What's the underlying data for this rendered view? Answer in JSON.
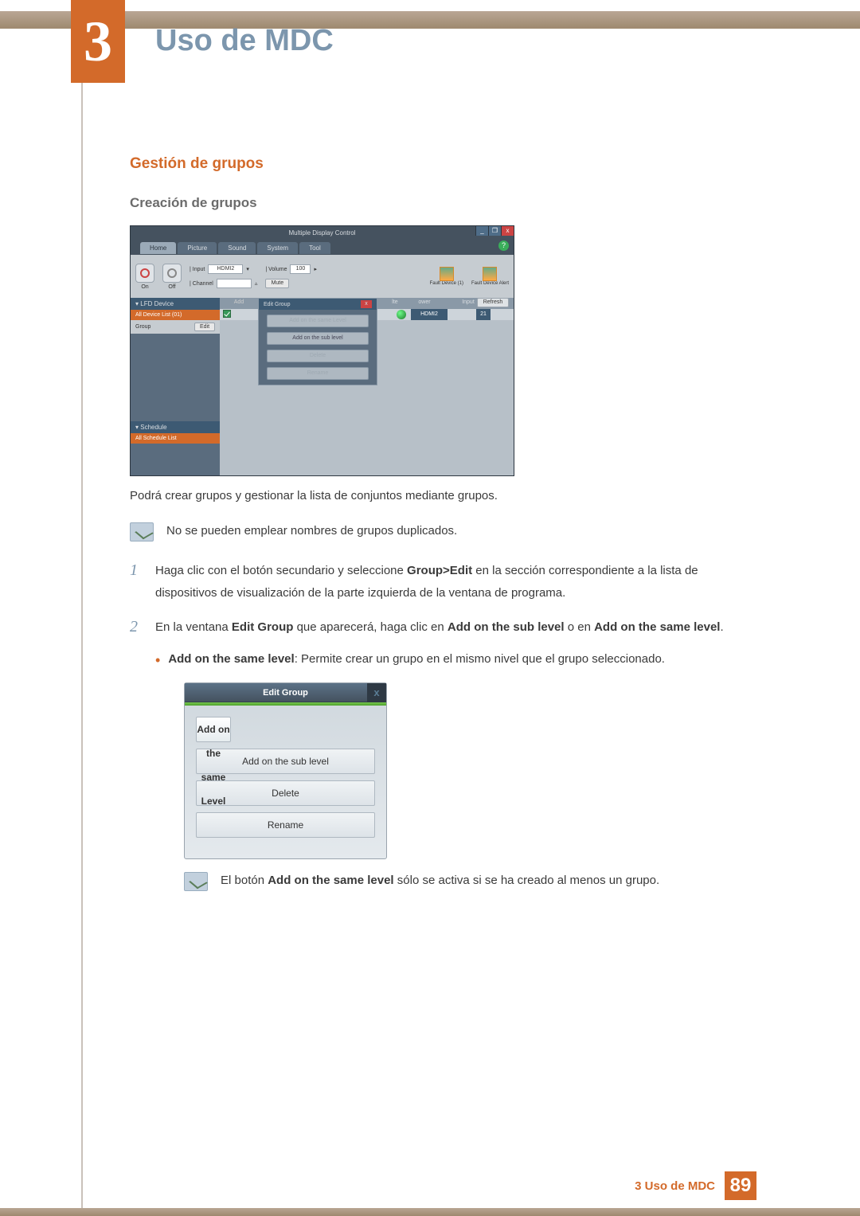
{
  "chapter": {
    "number": "3",
    "title": "Uso de MDC"
  },
  "h1": "Gestión de grupos",
  "h2": "Creación de grupos",
  "mdc": {
    "title": "Multiple Display Control",
    "win_min": "_",
    "win_max": "❐",
    "win_close": "x",
    "help": "?",
    "tabs": [
      "Home",
      "Picture",
      "Sound",
      "System",
      "Tool"
    ],
    "toolbar": {
      "on": "On",
      "off": "Off",
      "input_label": "| Input",
      "input_value": "HDMI2",
      "channel_label": "| Channel",
      "volume_label": "| Volume",
      "volume_value": "100",
      "mute": "Mute",
      "fault_log": "Fault Device (1)",
      "fault_alert": "Fault Device Alert"
    },
    "sidebar": {
      "lfd": "▾  LFD Device",
      "all_dev": "All Device List (01)",
      "group": "Group",
      "edit": "Edit",
      "schedule": "▾  Schedule",
      "all_sched": "All Schedule List"
    },
    "main": {
      "add": "Add",
      "refresh": "Refresh",
      "col_lte": "lte",
      "col_power": "ower",
      "col_input": "Input",
      "row_input": "HDMI2",
      "row_num": "21"
    },
    "popup": {
      "title": "Edit Group",
      "close": "x",
      "b1": "Add on the same Level",
      "b2": "Add on the sub level",
      "b3": "Delete",
      "b4": "Rename"
    }
  },
  "p_after": "Podrá crear grupos y gestionar la lista de conjuntos mediante grupos.",
  "note1": "No se pueden emplear nombres de grupos duplicados.",
  "steps": {
    "s1_num": "1",
    "s1_a": "Haga clic con el botón secundario y seleccione ",
    "s1_b": "Group>Edit",
    "s1_c": " en la sección correspondiente a la lista de dispositivos de visualización de la parte izquierda de la ventana de programa.",
    "s2_num": "2",
    "s2_a": "En la ventana ",
    "s2_b": "Edit Group",
    "s2_c": " que aparecerá, haga clic en ",
    "s2_d": "Add on the sub level",
    "s2_e": " o en ",
    "s2_f": "Add on the same level",
    "s2_g": ".",
    "bullet_a": "Add on the same level",
    "bullet_b": ": Permite crear un grupo en el mismo nivel que el grupo seleccionado."
  },
  "dlg": {
    "title": "Edit Group",
    "close": "x",
    "b1": "Add on the same Level",
    "b2": "Add on the sub level",
    "b3": "Delete",
    "b4": "Rename"
  },
  "note2_a": "El botón ",
  "note2_b": "Add on the same level",
  "note2_c": " sólo se activa si se ha creado al menos un grupo.",
  "footer": {
    "text": "3 Uso de MDC",
    "page": "89"
  }
}
